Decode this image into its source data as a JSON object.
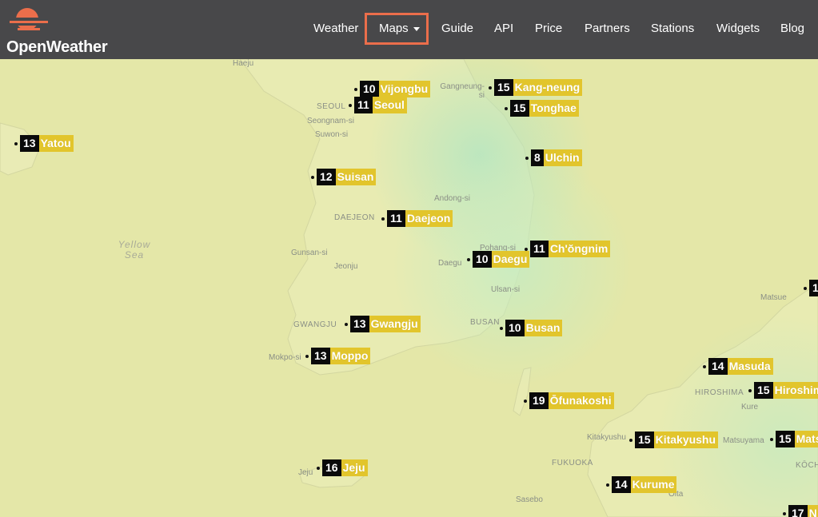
{
  "header": {
    "brand": "OpenWeather",
    "nav": [
      {
        "label": "Weather"
      },
      {
        "label": "Maps"
      },
      {
        "label": "Guide"
      },
      {
        "label": "API"
      },
      {
        "label": "Price"
      },
      {
        "label": "Partners"
      },
      {
        "label": "Stations"
      },
      {
        "label": "Widgets"
      },
      {
        "label": "Blog"
      }
    ]
  },
  "colors": {
    "header_bg": "#48484a",
    "logo": "#eb6e4b",
    "highlight_box": "#eb6e4b",
    "city_label_bg": "#e2c52c",
    "temp_bg": "#0a0a0a"
  },
  "map": {
    "places": [
      "Haeju",
      "SEOUL",
      "Seongnam-si",
      "Suwon-si",
      "Gangneung-si",
      "Andong-si",
      "DAEJEON",
      "Gunsan-si",
      "Jeonju",
      "Pohang-si",
      "Daegu",
      "Ulsan-si",
      "GWANGJU",
      "Mokpo-si",
      "BUSAN",
      "Jeju",
      "Matsue",
      "HIROSHIMA",
      "Kure",
      "Kitakyushu",
      "FUKUOKA",
      "Matsuyama",
      "Sasebo",
      "Oita",
      "KŌCHI"
    ],
    "sea_label": [
      "Yellow",
      "Sea"
    ],
    "markers": [
      {
        "temp": "13",
        "city": "Yatou"
      },
      {
        "temp": "10",
        "city": "Vijongbu"
      },
      {
        "temp": "11",
        "city": "Seoul"
      },
      {
        "temp": "15",
        "city": "Kang-neung"
      },
      {
        "temp": "15",
        "city": "Tonghae"
      },
      {
        "temp": "8",
        "city": "Ulchin"
      },
      {
        "temp": "12",
        "city": "Suisan"
      },
      {
        "temp": "11",
        "city": "Daejeon"
      },
      {
        "temp": "11",
        "city": "Ch'ŏngnim"
      },
      {
        "temp": "10",
        "city": "Daegu"
      },
      {
        "temp": "13",
        "city": "Gwangju"
      },
      {
        "temp": "10",
        "city": "Busan"
      },
      {
        "temp": "13",
        "city": "Moppo"
      },
      {
        "temp": "14",
        "city": "Masuda"
      },
      {
        "temp": "15",
        "city": "Hiroshim"
      },
      {
        "temp": "19",
        "city": "Ōfunakoshi"
      },
      {
        "temp": "15",
        "city": "Kitakyushu"
      },
      {
        "temp": "15",
        "city": "Mats"
      },
      {
        "temp": "16",
        "city": "Jeju"
      },
      {
        "temp": "14",
        "city": "Kurume"
      },
      {
        "temp": "17",
        "city": "N"
      },
      {
        "temp": "1",
        "city": ""
      }
    ]
  }
}
